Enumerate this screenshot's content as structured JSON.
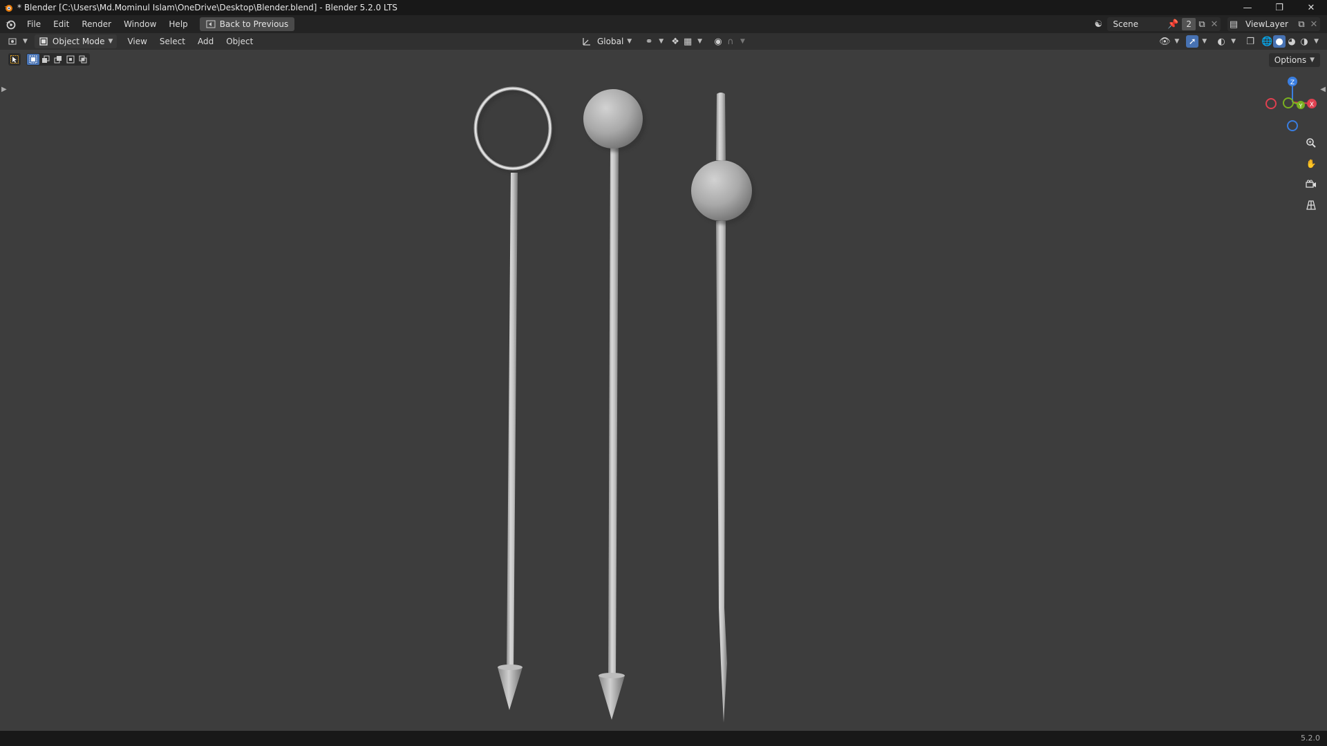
{
  "window": {
    "title": "* Blender [C:\\Users\\Md.Mominul Islam\\OneDrive\\Desktop\\Blender.blend] - Blender 5.2.0 LTS"
  },
  "menu": {
    "items": [
      "File",
      "Edit",
      "Render",
      "Window",
      "Help"
    ],
    "back_button": "Back to Previous"
  },
  "top_right": {
    "scene_label": "Scene",
    "scene_users": "2",
    "view_layer_label": "ViewLayer"
  },
  "viewport_header": {
    "mode": "Object Mode",
    "menus": [
      "View",
      "Select",
      "Add",
      "Object"
    ],
    "orientation": "Global"
  },
  "viewport": {
    "options_label": "Options",
    "axes": {
      "z": "Z",
      "y": "Y",
      "x": "X"
    }
  },
  "status_bar": {
    "version": "5.2.0"
  },
  "colors": {
    "background": "#3d3d3d",
    "header": "#303030",
    "topbar": "#232323",
    "accent": "#4772b3",
    "axis_x": "#e04050",
    "axis_y": "#7ab020",
    "axis_z": "#3a7ee0"
  },
  "icons": [
    "blender-logo-icon",
    "back-icon",
    "scene-icon",
    "pin-icon",
    "view-layer-icon",
    "editor-type-icon",
    "object-mode-icon",
    "transform-orientation-icon",
    "pivot-icon",
    "snap-icon",
    "proportional-edit-icon",
    "visibility-icon",
    "gizmo-icon",
    "overlay-icon",
    "xray-icon",
    "wireframe-shading-icon",
    "solid-shading-icon",
    "material-shading-icon",
    "rendered-shading-icon",
    "select-box-icon",
    "zoom-icon",
    "hand-pan-icon",
    "camera-icon",
    "grid-view-icon"
  ]
}
